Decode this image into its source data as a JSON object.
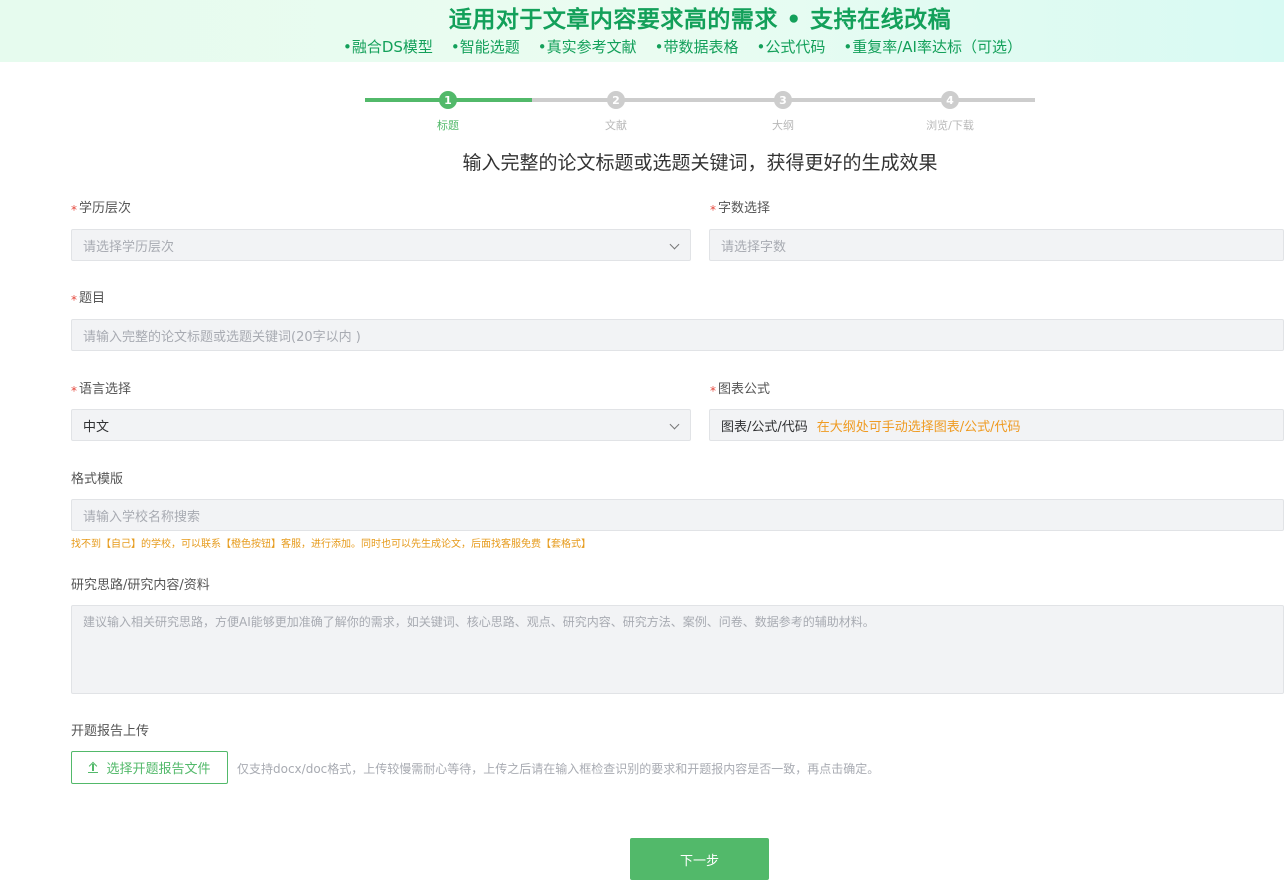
{
  "banner": {
    "title": "适用对于文章内容要求高的需求 • 支持在线改稿",
    "features": [
      "•融合DS模型",
      "•智能选题",
      "•真实参考文献",
      "•带数据表格",
      "•公式代码",
      "•重复率/AI率达标（可选）"
    ]
  },
  "stepper": {
    "current": 1,
    "steps": [
      {
        "number": "1",
        "label": "标题"
      },
      {
        "number": "2",
        "label": "文献"
      },
      {
        "number": "3",
        "label": "大纲"
      },
      {
        "number": "4",
        "label": "浏览/下载"
      }
    ]
  },
  "heading": "输入完整的论文标题或选题关键词，获得更好的生成效果",
  "form": {
    "required_mark": "*",
    "education": {
      "label": "学历层次",
      "placeholder": "请选择学历层次"
    },
    "wordcount": {
      "label": "字数选择",
      "placeholder": "请选择字数"
    },
    "topic": {
      "label": "题目",
      "placeholder": "请输入完整的论文标题或选题关键词(20字以内 )"
    },
    "language": {
      "label": "语言选择",
      "value": "中文"
    },
    "charts": {
      "label": "图表公式",
      "value": "图表/公式/代码",
      "note": "在大纲处可手动选择图表/公式/代码"
    },
    "template": {
      "label": "格式模版",
      "placeholder": "请输入学校名称搜索",
      "hint": "找不到【自己】的学校，可以联系【橙色按钮】客服，进行添加。同时也可以先生成论文，后面找客服免费【套格式】"
    },
    "research": {
      "label": "研究思路/研究内容/资料",
      "placeholder": "建议输入相关研究思路，方便AI能够更加准确了解你的需求，如关键词、核心思路、观点、研究内容、研究方法、案例、问卷、数据参考的辅助材料。"
    },
    "upload": {
      "label": "开题报告上传",
      "button": "选择开题报告文件",
      "hint": "仅支持docx/doc格式，上传较慢需耐心等待，上传之后请在输入框检查识别的要求和开题报内容是否一致，再点击确定。"
    },
    "next_button": "下一步"
  },
  "colors": {
    "accent": "#52b96a",
    "banner_text": "#13a05a",
    "warning": "#ef9b22",
    "required": "#e5483d"
  }
}
